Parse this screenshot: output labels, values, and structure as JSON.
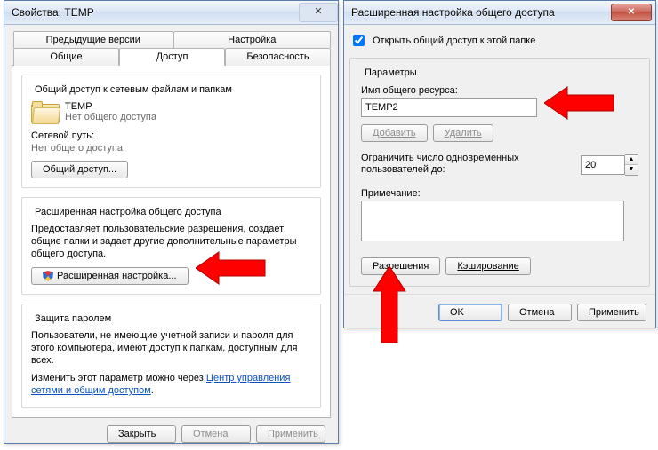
{
  "left": {
    "title": "Свойства: TEMP",
    "tabs_top": [
      "Предыдущие версии",
      "Настройка"
    ],
    "tabs_bottom": [
      "Общие",
      "Доступ",
      "Безопасность"
    ],
    "active_tab": "Доступ",
    "group1": {
      "title": "Общий доступ к сетевым файлам и папкам",
      "folder_name": "TEMP",
      "folder_status": "Нет общего доступа",
      "net_path_label": "Сетевой путь:",
      "net_path_value": "Нет общего доступа",
      "share_btn": "Общий доступ..."
    },
    "group2": {
      "title": "Расширенная настройка общего доступа",
      "desc": "Предоставляет пользовательские разрешения, создает общие папки и задает другие дополнительные параметры общего доступа.",
      "btn": "Расширенная настройка..."
    },
    "group3": {
      "title": "Защита паролем",
      "desc": "Пользователи, не имеющие учетной записи и пароля для этого компьютера, имеют доступ к папкам, доступным для всех.",
      "link_prefix": "Изменить этот параметр можно через ",
      "link": "Центр управления сетями и общим доступом",
      "link_suffix": "."
    },
    "footer": {
      "close": "Закрыть",
      "cancel": "Отмена",
      "apply": "Применить"
    }
  },
  "right": {
    "title": "Расширенная настройка общего доступа",
    "chk_label": "Открыть общий доступ к этой папке",
    "fieldset": "Параметры",
    "share_name_label": "Имя общего ресурса:",
    "share_name_value": "TEMP2",
    "add_btn": "Добавить",
    "del_btn": "Удалить",
    "limit_label": "Ограничить число одновременных пользователей до:",
    "limit_value": "20",
    "comment_label": "Примечание:",
    "perm_btn": "Разрешения",
    "cache_btn": "Кэширование",
    "ok": "OK",
    "cancel": "Отмена",
    "apply": "Применить"
  }
}
